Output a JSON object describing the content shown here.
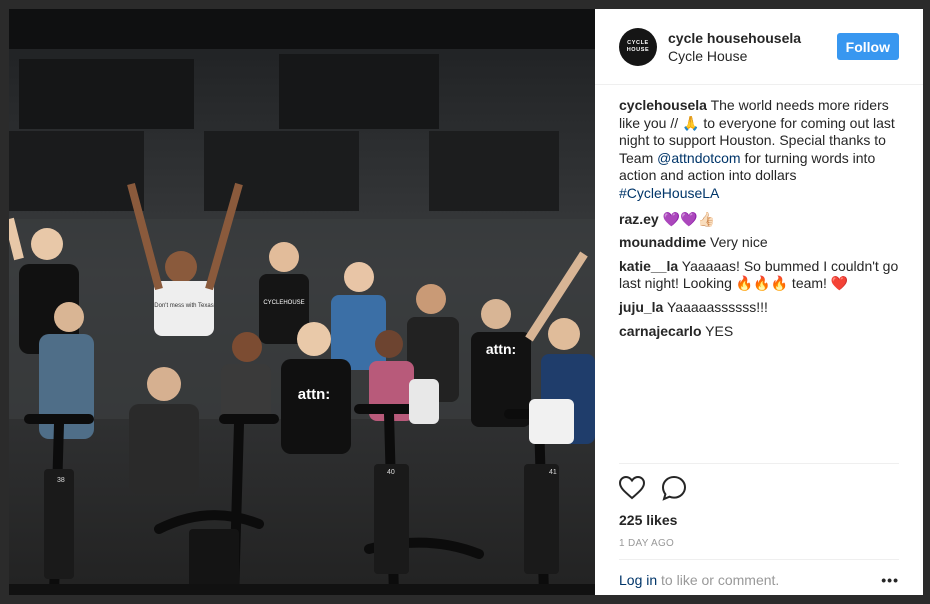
{
  "post": {
    "username": "cycle househousela",
    "location": "Cycle House",
    "avatar_text_1": "CYCLE",
    "avatar_text_2": "HOUSE",
    "follow_label": "Follow"
  },
  "caption": {
    "user": "cyclehousela",
    "text_1": " The world needs more riders like you // ",
    "emoji_1": "🙏",
    "text_2": " to everyone for coming out last night to support Houston. Special thanks to Team ",
    "mention": "@attndotcom",
    "text_3": " for turning words into action and action into dollars ",
    "hashtag": "#CycleHouseLA"
  },
  "comments": [
    {
      "user": "raz.ey",
      "text": " 💜💜👍🏻"
    },
    {
      "user": "mounaddime",
      "text": " Very nice"
    },
    {
      "user": "katie__la",
      "text": " Yaaaaas! So bummed I couldn't go last night! Looking 🔥🔥🔥 team! ❤️"
    },
    {
      "user": "juju_la",
      "text": " Yaaaaassssss!!!"
    },
    {
      "user": "carnajecarlo",
      "text": " YES"
    }
  ],
  "likes": "225 likes",
  "time_ago": "1 DAY AGO",
  "footer": {
    "login_link": "Log in",
    "login_text": " to like or comment.",
    "more_label": "•••"
  },
  "photo_text": {
    "shirt_1": "attn:",
    "shirt_2": "attn:",
    "shirt_3": "CYCLEHOUSE",
    "shirt_4": "Don't mess with Texas",
    "bike_1": "38",
    "bike_2": "40",
    "bike_3": "41"
  },
  "colors": {
    "accent": "#3897f0",
    "text": "#262626",
    "muted": "#999999",
    "link": "#003569"
  },
  "icons": [
    "heart-icon",
    "comment-icon"
  ]
}
